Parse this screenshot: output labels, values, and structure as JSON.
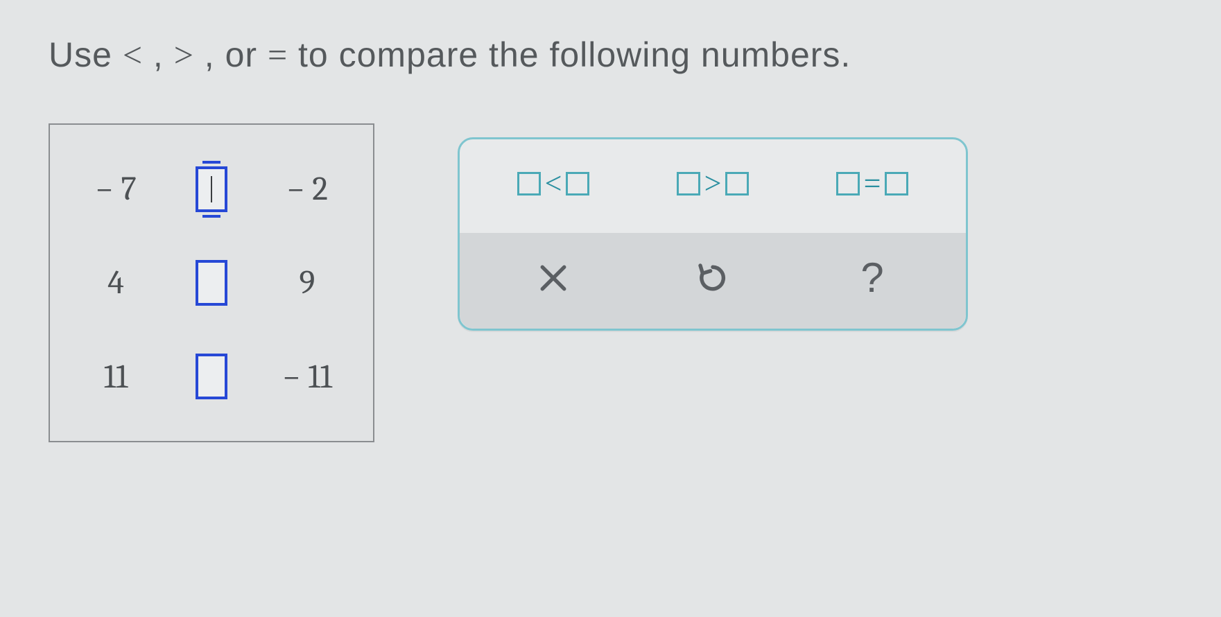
{
  "prompt": {
    "p1": "Use ",
    "lt": "<",
    "comma1": " , ",
    "gt": ">",
    "comma2": " , or ",
    "eq": "=",
    "p2": " to compare the following numbers."
  },
  "rows": [
    {
      "left": "− 7",
      "right": "− 2",
      "active": true
    },
    {
      "left": "4",
      "right": "9",
      "active": false
    },
    {
      "left": "11",
      "right": "− 11",
      "active": false
    }
  ],
  "operators": {
    "lt": "<",
    "gt": ">",
    "eq": "="
  },
  "tools": {
    "help": "?"
  }
}
